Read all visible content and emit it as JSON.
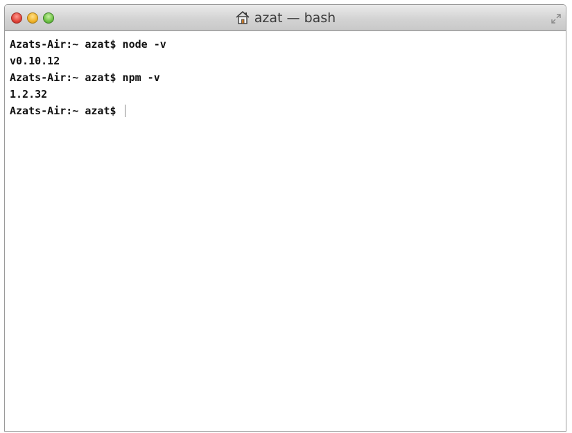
{
  "window": {
    "title": "azat — bash",
    "title_icon": "home-icon",
    "colors": {
      "close": "#e0443a",
      "minimize": "#f0b42a",
      "zoom": "#6fc246"
    }
  },
  "terminal": {
    "lines": [
      "Azats-Air:~ azat$ node -v",
      "v0.10.12",
      "Azats-Air:~ azat$ npm -v",
      "1.2.32",
      "Azats-Air:~ azat$ "
    ]
  }
}
